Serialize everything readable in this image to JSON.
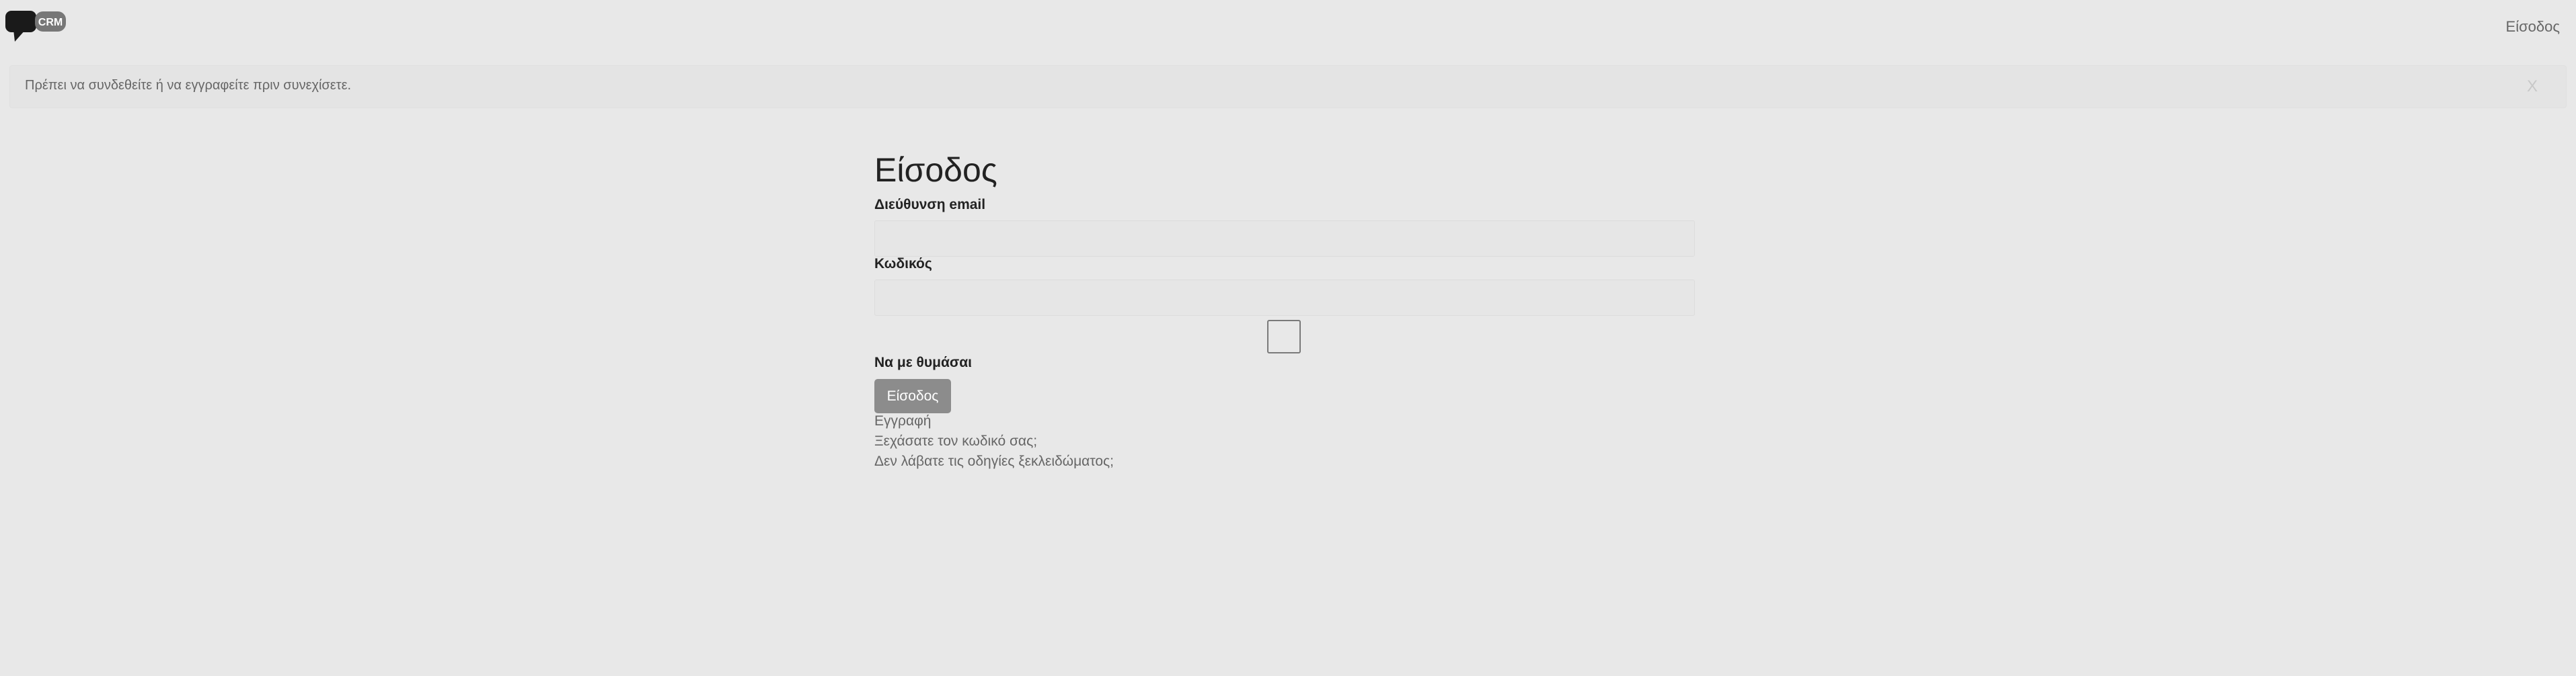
{
  "header": {
    "logo_text": "CRM",
    "signin_link": "Είσοδος"
  },
  "alert": {
    "message": "Πρέπει να συνδεθείτε ή να εγγραφείτε πριν συνεχίσετε.",
    "close_label": "X"
  },
  "form": {
    "title": "Είσοδος",
    "email_label": "Διεύθυνση email",
    "email_value": "",
    "password_label": "Κωδικός",
    "password_value": "",
    "remember_label": "Να με θυμάσαι",
    "remember_checked": false,
    "submit_label": "Είσοδος"
  },
  "links": {
    "signup": "Εγγραφή",
    "forgot_password": "Ξεχάσατε τον κωδικό σας;",
    "unlock_instructions": "Δεν λάβατε τις οδηγίες ξεκλειδώματος;"
  },
  "colors": {
    "background": "#e8e8e8",
    "button": "#8c8c8c",
    "logo_dark": "#1a1a1a",
    "logo_badge": "#777777"
  }
}
